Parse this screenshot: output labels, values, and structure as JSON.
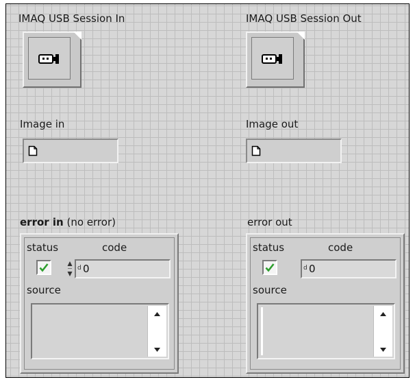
{
  "session_in": {
    "label": "IMAQ USB Session In",
    "icon": "usb-camera-icon"
  },
  "session_out": {
    "label": "IMAQ USB Session Out",
    "icon": "usb-camera-icon"
  },
  "image_in": {
    "label": "Image in",
    "icon": "image-file-icon"
  },
  "image_out": {
    "label": "Image out",
    "icon": "image-file-icon"
  },
  "error_in": {
    "label_bold": "error in",
    "label_note": " (no error)",
    "status_label": "status",
    "code_label": "code",
    "radix": "d",
    "code_value": "0",
    "source_label": "source",
    "status_checked": true
  },
  "error_out": {
    "label": "error out",
    "status_label": "status",
    "code_label": "code",
    "radix": "d",
    "code_value": "0",
    "source_label": "source",
    "status_checked": true
  },
  "colors": {
    "panel_bg": "#d7d7d7",
    "grid": "#bdbdbd",
    "check_green": "#2e9e2e"
  }
}
